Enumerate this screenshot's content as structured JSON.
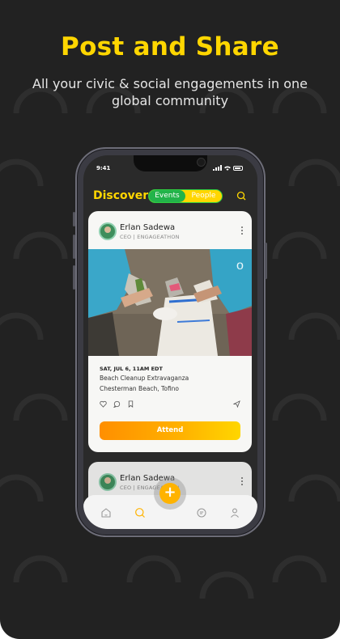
{
  "hero": {
    "headline": "Post and Share",
    "subline": "All your civic & social engagements in one global community"
  },
  "status_bar": {
    "time": "9:41"
  },
  "header": {
    "title": "Discover",
    "tabs": [
      {
        "label": "Events",
        "active": true
      },
      {
        "label": "People",
        "active": false
      }
    ],
    "search_icon": "search-icon"
  },
  "post": {
    "author": "Erlan Sadewa",
    "role": "CEO | ENGAGEATHON",
    "date": "SAT, JUL 6, 11AM EDT",
    "title": "Beach Cleanup Extravaganza",
    "location": "Chesterman Beach, Tofino",
    "attend_label": "Attend",
    "icons": [
      "heart-icon",
      "comment-icon",
      "bookmark-icon",
      "send-icon"
    ]
  },
  "post2": {
    "author": "Erlan Sadewa",
    "role": "CEO | ENGAGEATHON"
  },
  "nav": {
    "items": [
      "home-icon",
      "search-icon",
      "add-icon",
      "chat-icon",
      "profile-icon"
    ],
    "fab_symbol": "+"
  },
  "colors": {
    "accent": "#FFD600",
    "orange": "#FFB300",
    "green": "#22b34a",
    "background": "#222222"
  }
}
